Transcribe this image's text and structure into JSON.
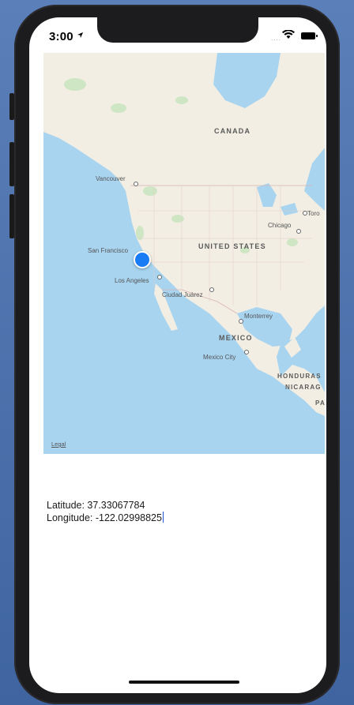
{
  "status_bar": {
    "time": "3:00",
    "location_icon": "location-arrow-icon",
    "signal_text": "....",
    "wifi_icon": "wifi-icon",
    "battery_icon": "battery-icon"
  },
  "map": {
    "countries": [
      "CANADA",
      "UNITED STATES",
      "MEXICO"
    ],
    "cities": {
      "vancouver": "Vancouver",
      "san_francisco": "San Francisco",
      "los_angeles": "Los Angeles",
      "chicago": "Chicago",
      "toronto": "Toro",
      "ciudad_juarez": "Ciudad Juárez",
      "monterrey": "Monterrey",
      "mexico_city": "Mexico City",
      "honduras": "HONDURAS",
      "nicaragua": "NICARAG",
      "panama": "PA"
    },
    "legal": "Legal",
    "colors": {
      "water": "#a8d4f0",
      "land": "#f2eee4",
      "park": "#cfe6c4",
      "user_location": "#1a7cf5"
    }
  },
  "coordinates": {
    "latitude_text": "Latitude: 37.33067784",
    "longitude_text": "Longitude: -122.02998825"
  }
}
